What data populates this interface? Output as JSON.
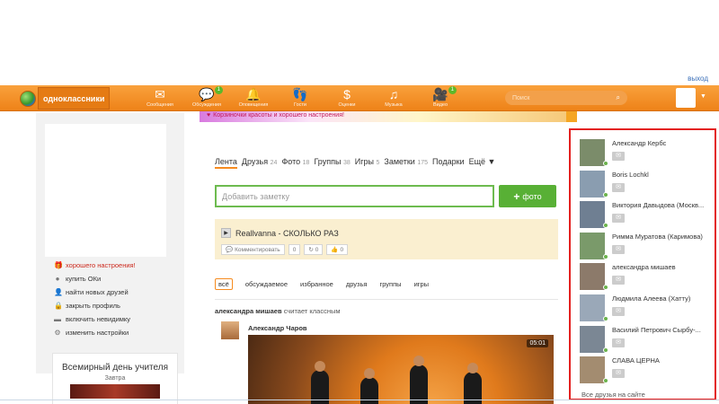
{
  "header": {
    "logout": "выход",
    "site_name": "одноклассники",
    "nav": [
      {
        "label": "Сообщения",
        "icon": "envelope-icon",
        "glyph": "✉",
        "badge": ""
      },
      {
        "label": "Обсуждения",
        "icon": "chat-bubbles-icon",
        "glyph": "💬",
        "badge": "1"
      },
      {
        "label": "Оповещения",
        "icon": "bell-icon",
        "glyph": "🔔",
        "badge": ""
      },
      {
        "label": "Гости",
        "icon": "footprints-icon",
        "glyph": "👣",
        "badge": ""
      },
      {
        "label": "Оценки",
        "icon": "rating-icon",
        "glyph": "$",
        "badge": ""
      },
      {
        "label": "Музыка",
        "icon": "music-icon",
        "glyph": "♫",
        "badge": ""
      },
      {
        "label": "Видео",
        "icon": "video-icon",
        "glyph": "🎥",
        "badge": "1"
      }
    ],
    "search_placeholder": "Поиск"
  },
  "banner": {
    "text": "Корзиночки красоты и хорошего настроения!"
  },
  "left": {
    "links": [
      {
        "label": "хорошего настроения!",
        "icon": "gift-icon",
        "glyph": "🎁"
      },
      {
        "label": "купить ОКи",
        "icon": "coin-icon",
        "glyph": "●"
      },
      {
        "label": "найти новых друзей",
        "icon": "user-icon",
        "glyph": "👤"
      },
      {
        "label": "закрыть профиль",
        "icon": "lock-icon",
        "glyph": "🔒"
      },
      {
        "label": "включить невидимку",
        "icon": "invisible-icon",
        "glyph": "▬"
      },
      {
        "label": "изменить настройки",
        "icon": "gear-icon",
        "glyph": "⚙"
      }
    ],
    "holiday": {
      "title": "Всемирный день учителя",
      "sub": "Завтра"
    }
  },
  "feed": {
    "tabs": [
      {
        "label": "Лента",
        "count": ""
      },
      {
        "label": "Друзья",
        "count": "24"
      },
      {
        "label": "Фото",
        "count": "18"
      },
      {
        "label": "Группы",
        "count": "38"
      },
      {
        "label": "Игры",
        "count": "5"
      },
      {
        "label": "Заметки",
        "count": "175"
      },
      {
        "label": "Подарки",
        "count": ""
      },
      {
        "label": "Ещё ▼",
        "count": ""
      }
    ],
    "note_placeholder": "Добавить заметку",
    "photo_button": "фото",
    "status": {
      "track": "Reallvanna - СКОЛЬКО РАЗ",
      "comment": "Комментировать",
      "comments": "0",
      "shares": "0",
      "likes": "0"
    },
    "filters": [
      "всё",
      "обсуждаемое",
      "избранное",
      "друзья",
      "группы",
      "игры"
    ],
    "post": {
      "who": "александра мишаев",
      "action": "считает классным",
      "author": "Александр Чаров",
      "duration": "05:01"
    }
  },
  "friends_online": {
    "items": [
      {
        "name": "Александр Кербс"
      },
      {
        "name": "Boris Lochkl"
      },
      {
        "name": "Виктория Давыдова (Москв..."
      },
      {
        "name": "Римма Муратова (Каримова)"
      },
      {
        "name": "александра мишаев"
      },
      {
        "name": "Людмила Алеева (Хатту)"
      },
      {
        "name": "Василий Петрович Сырбу-..."
      },
      {
        "name": "СЛАВА ЦЕРНА"
      }
    ],
    "all_link": "Все друзья на сайте"
  }
}
